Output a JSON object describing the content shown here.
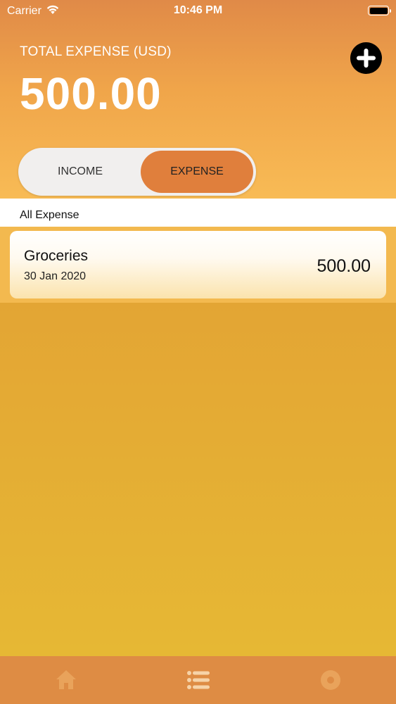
{
  "status_bar": {
    "carrier": "Carrier",
    "time": "10:46 PM"
  },
  "header": {
    "total_label": "TOTAL EXPENSE (USD)",
    "total_value": "500.00",
    "add_icon": "plus-circle-icon"
  },
  "segment": {
    "income_label": "INCOME",
    "expense_label": "EXPENSE",
    "selected": "EXPENSE"
  },
  "section": {
    "title": "All Expense"
  },
  "items": [
    {
      "title": "Groceries",
      "date": "30 Jan 2020",
      "amount": "500.00"
    }
  ],
  "tab_bar": {
    "tabs": [
      {
        "icon": "home-icon"
      },
      {
        "icon": "list-icon"
      },
      {
        "icon": "gear-icon"
      }
    ],
    "selected_index": 1
  },
  "colors": {
    "accent": "#e07f3c",
    "header_top": "#e08a48",
    "header_bottom": "#f8bb55",
    "tab_bar": "#de8c44"
  }
}
